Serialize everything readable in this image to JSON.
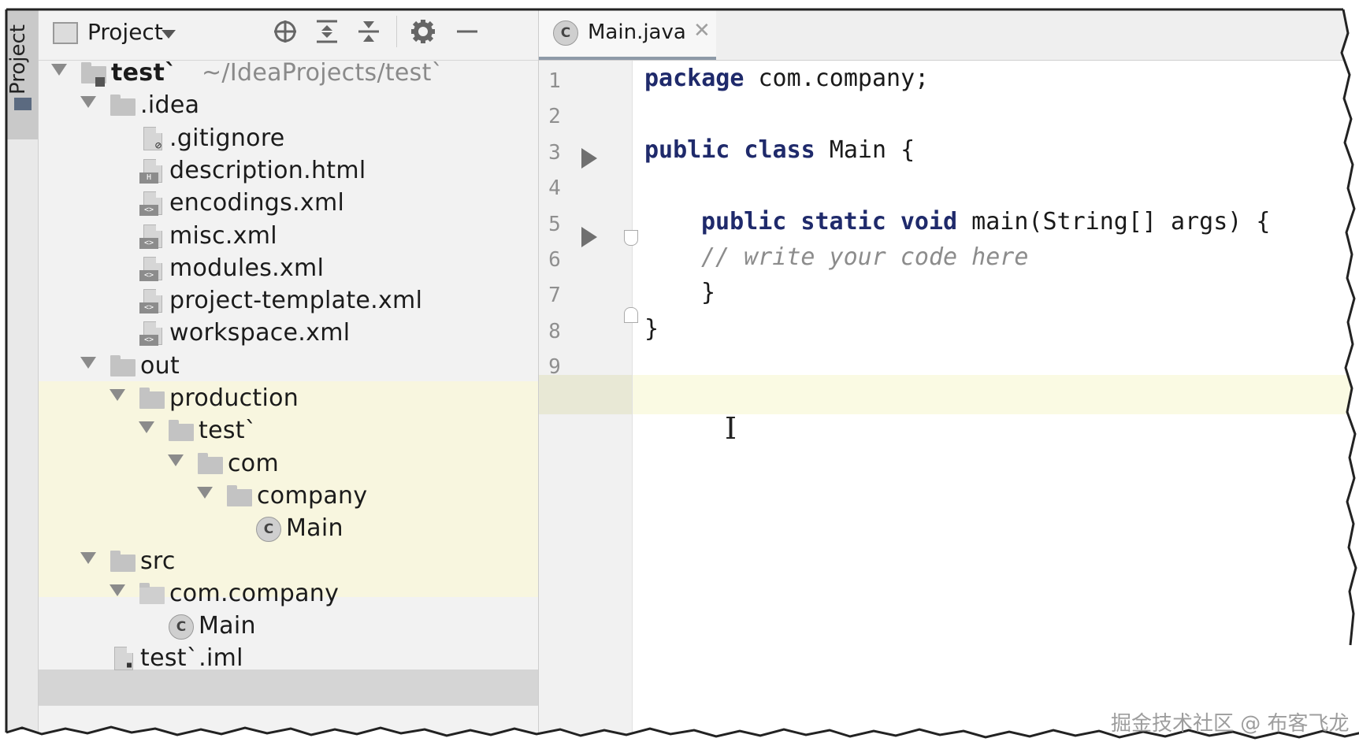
{
  "tool_strip": {
    "label": "Project"
  },
  "panel": {
    "title": "Project",
    "icons": [
      "locate-icon",
      "expand-all-icon",
      "collapse-all-icon",
      "gear-icon",
      "minimize-icon"
    ]
  },
  "tree": [
    {
      "name": "test`",
      "hint": "~/IdeaProjects/test`",
      "kind": "module-folder",
      "depth": 0,
      "expanded": true
    },
    {
      "name": ".idea",
      "kind": "folder",
      "depth": 1,
      "expanded": true
    },
    {
      "name": ".gitignore",
      "kind": "file-ignore",
      "depth": 2
    },
    {
      "name": "description.html",
      "kind": "file-html",
      "depth": 2
    },
    {
      "name": "encodings.xml",
      "kind": "file-xml",
      "depth": 2
    },
    {
      "name": "misc.xml",
      "kind": "file-xml",
      "depth": 2
    },
    {
      "name": "modules.xml",
      "kind": "file-xml",
      "depth": 2
    },
    {
      "name": "project-template.xml",
      "kind": "file-xml",
      "depth": 2
    },
    {
      "name": "workspace.xml",
      "kind": "file-xml",
      "depth": 2
    },
    {
      "name": "out",
      "kind": "folder",
      "depth": 1,
      "expanded": true,
      "excluded": true
    },
    {
      "name": "production",
      "kind": "folder",
      "depth": 2,
      "expanded": true,
      "excluded": true
    },
    {
      "name": "test`",
      "kind": "folder",
      "depth": 3,
      "expanded": true,
      "excluded": true
    },
    {
      "name": "com",
      "kind": "folder",
      "depth": 4,
      "expanded": true,
      "excluded": true
    },
    {
      "name": "company",
      "kind": "folder",
      "depth": 5,
      "expanded": true,
      "excluded": true
    },
    {
      "name": "Main",
      "kind": "class",
      "depth": 6,
      "excluded": true
    },
    {
      "name": "src",
      "kind": "source-folder",
      "depth": 1,
      "expanded": true
    },
    {
      "name": "com.company",
      "kind": "package",
      "depth": 2,
      "expanded": true
    },
    {
      "name": "Main",
      "kind": "class",
      "depth": 3,
      "selected": true
    },
    {
      "name": "test`.iml",
      "kind": "file-iml",
      "depth": 1
    }
  ],
  "editor": {
    "tab_label": "Main.java",
    "line_numbers": [
      "1",
      "2",
      "3",
      "4",
      "5",
      "6",
      "7",
      "8",
      "9"
    ],
    "lines": [
      {
        "kw": "package",
        "rest": " com.company;"
      },
      {
        "kw": "",
        "rest": ""
      },
      {
        "kw": "public class",
        "rest": " Main {"
      },
      {
        "kw": "",
        "rest": ""
      },
      {
        "kw": "public static void",
        "rest": " main(String[] args) {"
      },
      {
        "comment": "// write your code here"
      },
      {
        "kw": "",
        "rest": "}"
      },
      {
        "kw": "",
        "rest": "}"
      },
      {
        "kw": "",
        "rest": ""
      }
    ],
    "current_line": 9
  },
  "colors": {
    "excluded_bg": "#f8f6df",
    "selected_bg": "#d5d5d5",
    "keyword": "#1f2a6b",
    "comment": "#8c8c8c",
    "current_line_bg": "#fafae3"
  },
  "watermark": "掘金技术社区 @ 布客飞龙"
}
